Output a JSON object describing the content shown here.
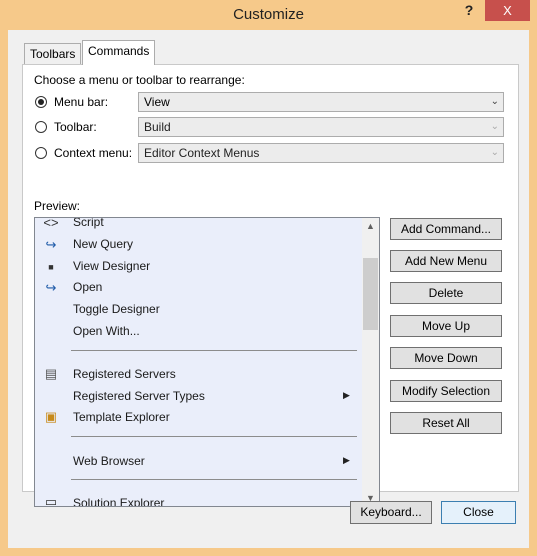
{
  "window": {
    "title": "Customize",
    "help_label": "?",
    "close_label": "X"
  },
  "tabs": [
    {
      "label": "Toolbars",
      "selected": false
    },
    {
      "label": "Commands",
      "selected": true
    }
  ],
  "rearrange": {
    "prompt": "Choose a menu or toolbar to rearrange:",
    "options": [
      {
        "label": "Menu bar:",
        "value": "View",
        "checked": true,
        "enabled": true
      },
      {
        "label": "Toolbar:",
        "value": "Build",
        "checked": false,
        "enabled": false
      },
      {
        "label": "Context menu:",
        "value": "Editor Context Menus",
        "checked": false,
        "enabled": false
      }
    ]
  },
  "preview": {
    "label": "Preview:",
    "items": [
      {
        "label": "Script",
        "icon": "script-icon",
        "glyph": "<>",
        "type": "item"
      },
      {
        "label": "New Query",
        "icon": "new-query-icon",
        "glyph": "↪",
        "type": "item"
      },
      {
        "label": "View Designer",
        "icon": "view-designer-icon",
        "glyph": "■",
        "type": "item"
      },
      {
        "label": "Open",
        "icon": "open-icon",
        "glyph": "↪",
        "type": "item"
      },
      {
        "label": "Toggle Designer",
        "icon": "",
        "glyph": "",
        "type": "item"
      },
      {
        "label": "Open With...",
        "icon": "",
        "glyph": "",
        "type": "item"
      },
      {
        "type": "separator"
      },
      {
        "label": "Registered Servers",
        "icon": "registered-servers-icon",
        "glyph": "▤",
        "type": "item"
      },
      {
        "label": "Registered Server Types",
        "icon": "",
        "glyph": "",
        "type": "submenu"
      },
      {
        "label": "Template Explorer",
        "icon": "template-explorer-icon",
        "glyph": "▣",
        "type": "item"
      },
      {
        "type": "separator"
      },
      {
        "label": "Web Browser",
        "icon": "",
        "glyph": "",
        "type": "submenu"
      },
      {
        "type": "separator"
      },
      {
        "label": "Solution Explorer",
        "icon": "solution-explorer-icon",
        "glyph": "▭",
        "type": "item"
      }
    ]
  },
  "buttons": {
    "add_command": "Add Command...",
    "add_new_menu": "Add New Menu",
    "delete": "Delete",
    "move_up": "Move Up",
    "move_down": "Move Down",
    "modify_selection": "Modify Selection",
    "reset_all": "Reset All"
  },
  "footer": {
    "keyboard": "Keyboard...",
    "close": "Close"
  },
  "colors": {
    "title_bar": "#f6c98a",
    "close_button": "#c7504c",
    "menu_preview_bg": "#eaeefa",
    "icon_blue": "#1e5aa8"
  }
}
